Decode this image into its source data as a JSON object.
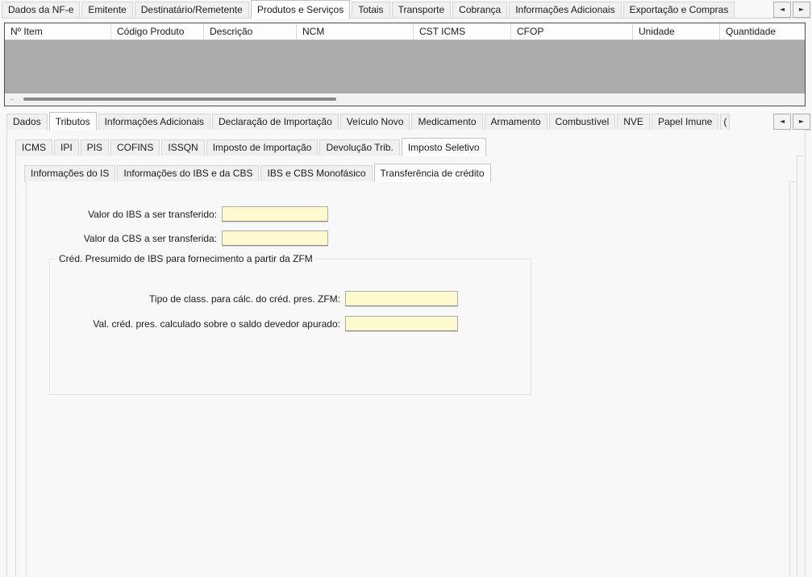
{
  "colors": {
    "input_bg": "#fffacd",
    "grid_body_bg": "#ababab",
    "page_bg": "#f8f8f8",
    "grid_border": "#4e4e4e"
  },
  "tab_scroll": {
    "left_arrow": "◄",
    "right_arrow": "►"
  },
  "tabs_nfe": {
    "selected": "Produtos e Serviços",
    "items": [
      "Dados da NF-e",
      "Emitente",
      "Destinatário/Remetente",
      "Produtos e Serviços",
      "Totais",
      "Transporte",
      "Cobrança",
      "Informações Adicionais",
      "Exportação e Compras"
    ]
  },
  "products_grid": {
    "columns": [
      "Nº Item",
      "Código Produto",
      "Descrição",
      "NCM",
      "CST ICMS",
      "CFOP",
      "Unidade",
      "Quantidade"
    ],
    "rows": []
  },
  "tabs_item": {
    "selected": "Tributos",
    "items": [
      "Dados",
      "Tributos",
      "Informações Adicionais",
      "Declaração de Importação",
      "Veículo Novo",
      "Medicamento",
      "Armamento",
      "Combustível",
      "NVE",
      "Papel Imune"
    ],
    "clipped_item": "("
  },
  "tabs_tributos": {
    "selected": "Imposto Seletivo",
    "items": [
      "ICMS",
      "IPI",
      "PIS",
      "COFINS",
      "ISSQN",
      "Imposto de Importação",
      "Devolução Trib.",
      "Imposto Seletivo"
    ]
  },
  "tabs_imposto_seletivo": {
    "selected": "Transferência de crédito",
    "items": [
      "Informações do IS",
      "Informações do IBS e da CBS",
      "IBS e CBS Monofásico",
      "Transferência de crédito"
    ]
  },
  "transfer_form": {
    "fields": [
      {
        "label": "Valor do IBS a ser transferido:",
        "value": ""
      },
      {
        "label": "Valor da CBS a ser transferida:",
        "value": ""
      }
    ],
    "zfm_group": {
      "title": "Créd. Presumido de IBS para fornecimento a partir da ZFM",
      "fields": [
        {
          "label": "Tipo de class. para cálc. do créd. pres. ZFM:",
          "value": ""
        },
        {
          "label": "Val. créd. pres. calculado sobre o saldo devedor apurado:",
          "value": ""
        }
      ]
    }
  }
}
